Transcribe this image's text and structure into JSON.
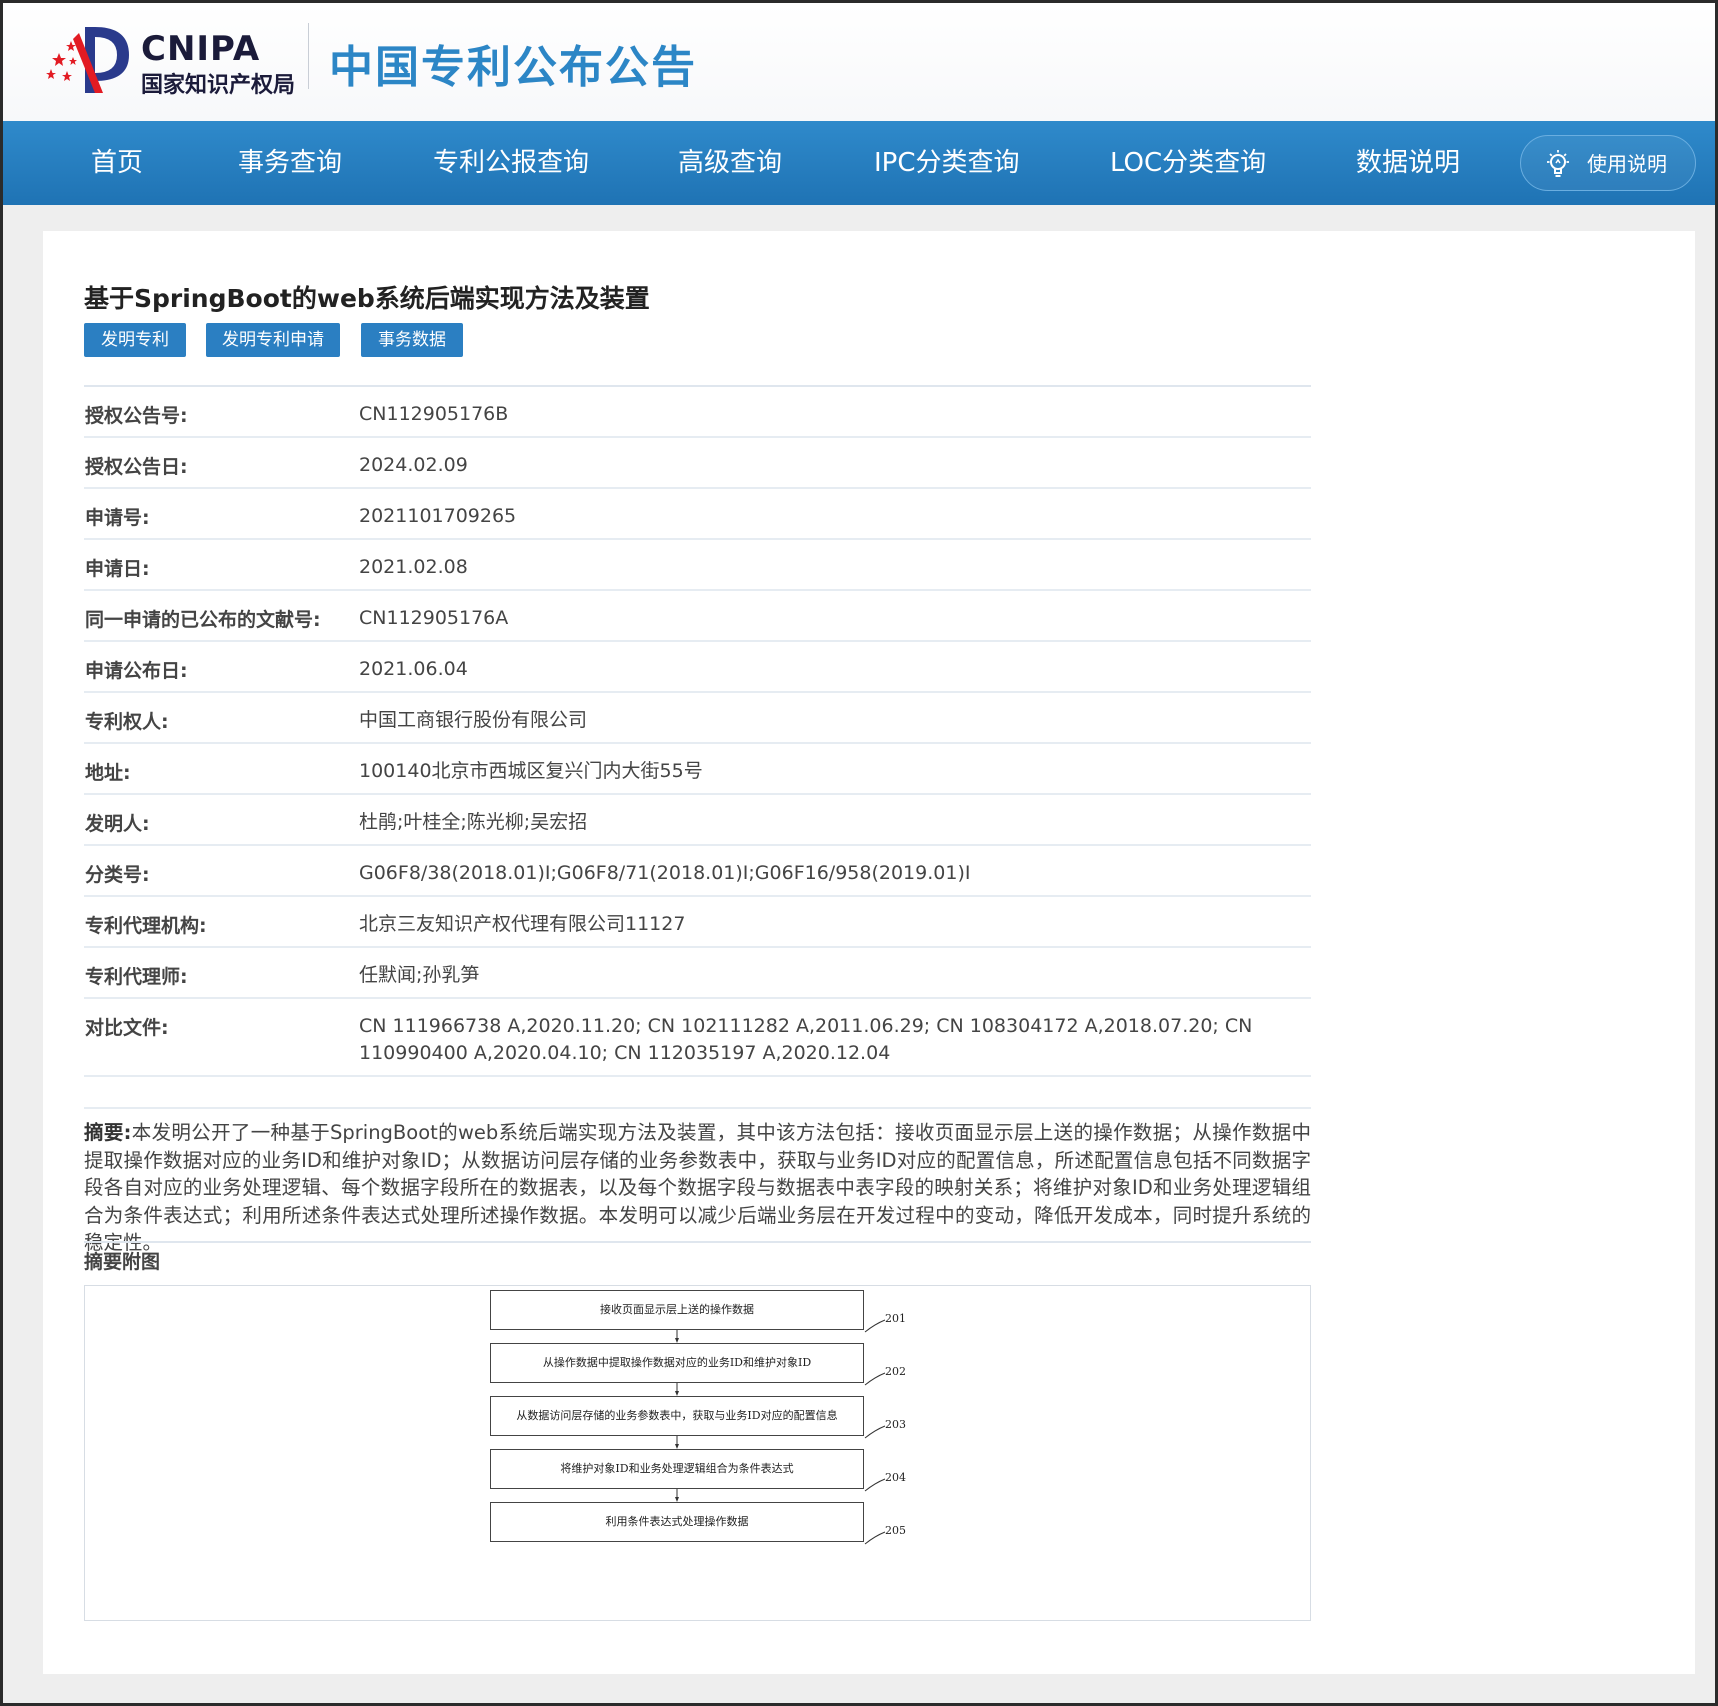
{
  "header": {
    "logo_en": "CNIPA",
    "logo_cn": "国家知识产权局",
    "site_title": "中国专利公布公告"
  },
  "nav": {
    "items": [
      {
        "label": "首页"
      },
      {
        "label": "事务查询"
      },
      {
        "label": "专利公报查询"
      },
      {
        "label": "高级查询"
      },
      {
        "label": "IPC分类查询"
      },
      {
        "label": "LOC分类查询"
      },
      {
        "label": "数据说明"
      }
    ],
    "help_label": "使用说明",
    "help_icon": "lightbulb-icon"
  },
  "patent": {
    "title": "基于SpringBoot的web系统后端实现方法及装置",
    "tags": [
      {
        "label": "发明专利"
      },
      {
        "label": "发明专利申请"
      },
      {
        "label": "事务数据"
      }
    ],
    "fields": [
      {
        "label": "授权公告号:",
        "value": "CN112905176B"
      },
      {
        "label": "授权公告日:",
        "value": "2024.02.09"
      },
      {
        "label": "申请号:",
        "value": "2021101709265"
      },
      {
        "label": "申请日:",
        "value": "2021.02.08"
      },
      {
        "label": "同一申请的已公布的文献号:",
        "value": "CN112905176A"
      },
      {
        "label": "申请公布日:",
        "value": "2021.06.04"
      },
      {
        "label": "专利权人:",
        "value": "中国工商银行股份有限公司"
      },
      {
        "label": "地址:",
        "value": "100140北京市西城区复兴门内大街55号"
      },
      {
        "label": "发明人:",
        "value": "杜鹃;叶桂全;陈光柳;吴宏招"
      },
      {
        "label": "分类号:",
        "value": "G06F8/38(2018.01)I;G06F8/71(2018.01)I;G06F16/958(2019.01)I"
      },
      {
        "label": "专利代理机构:",
        "value": "北京三友知识产权代理有限公司11127"
      },
      {
        "label": "专利代理师:",
        "value": "任默闻;孙乳笋"
      },
      {
        "label": "对比文件:",
        "value": "CN 111966738 A,2020.11.20; CN 102111282 A,2011.06.29; CN 108304172 A,2018.07.20; CN 110990400 A,2020.04.10; CN 112035197 A,2020.12.04"
      }
    ],
    "abstract_label": "摘要:",
    "abstract_text": "本发明公开了一种基于SpringBoot的web系统后端实现方法及装置，其中该方法包括：接收页面显示层上送的操作数据；从操作数据中提取操作数据对应的业务ID和维护对象ID；从数据访问层存储的业务参数表中，获取与业务ID对应的配置信息，所述配置信息包括不同数据字段各自对应的业务处理逻辑、每个数据字段所在的数据表，以及每个数据字段与数据表中表字段的映射关系；将维护对象ID和业务处理逻辑组合为条件表达式；利用所述条件表达式处理所述操作数据。本发明可以减少后端业务层在开发过程中的变动，降低开发成本，同时提升系统的稳定性。",
    "figure_title": "摘要附图",
    "figure_steps": [
      {
        "text": "接收页面显示层上送的操作数据",
        "ref": "201"
      },
      {
        "text": "从操作数据中提取操作数据对应的业务ID和维护对象ID",
        "ref": "202"
      },
      {
        "text": "从数据访问层存储的业务参数表中，获取与业务ID对应的配置信息",
        "ref": "203"
      },
      {
        "text": "将维护对象ID和业务处理逻辑组合为条件表达式",
        "ref": "204"
      },
      {
        "text": "利用条件表达式处理操作数据",
        "ref": "205"
      }
    ]
  }
}
